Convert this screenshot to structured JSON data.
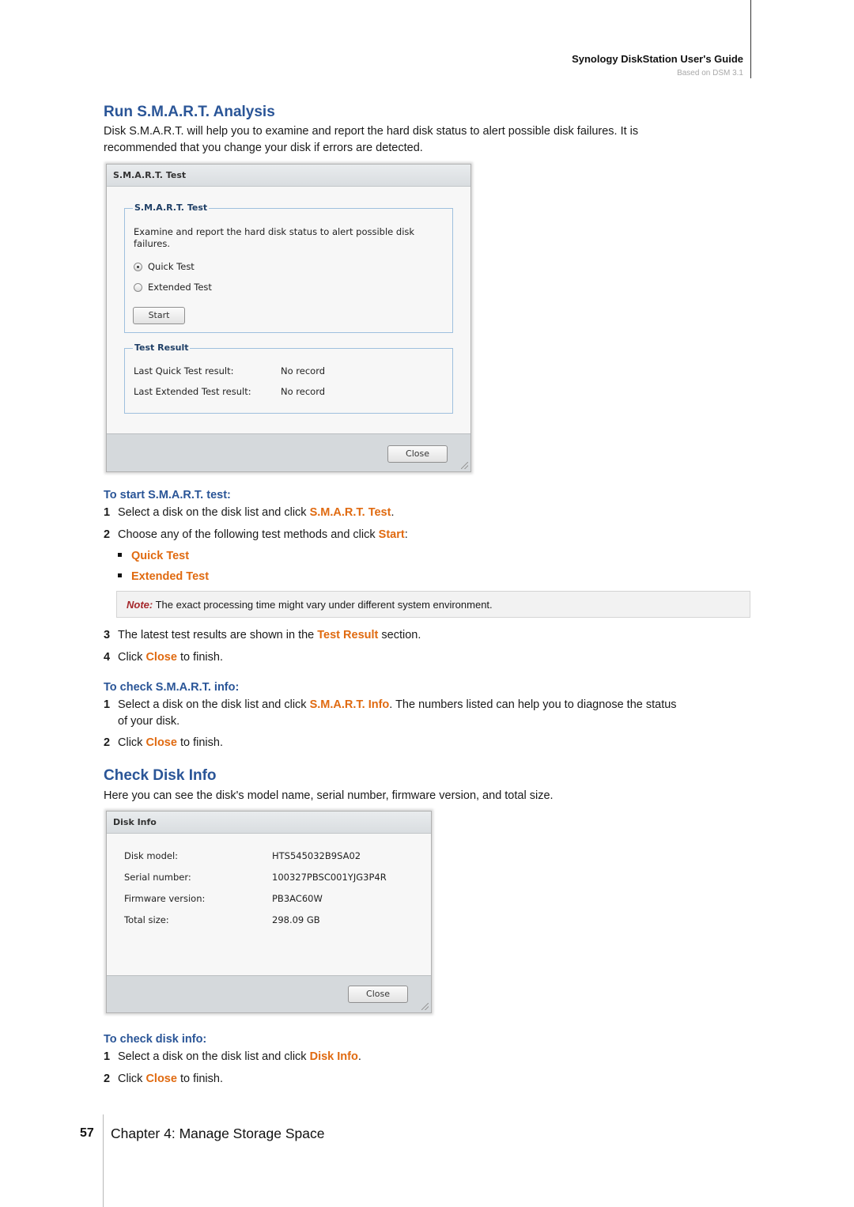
{
  "header": {
    "guide_title": "Synology DiskStation User's Guide",
    "based_on": "Based on DSM 3.1"
  },
  "smart_section": {
    "heading": "Run S.M.A.R.T. Analysis",
    "intro_line1": "Disk S.M.A.R.T. will help you to examine and report the hard disk status to alert possible disk failures. It is",
    "intro_line2": "recommended that you change your disk if errors are detected."
  },
  "smart_dialog": {
    "title": "S.M.A.R.T. Test",
    "test_group": {
      "legend": "S.M.A.R.T. Test",
      "description_line1": "Examine and report the hard disk status to alert possible disk",
      "description_line2": "failures.",
      "options": [
        {
          "label": "Quick Test",
          "selected": true
        },
        {
          "label": "Extended Test",
          "selected": false
        }
      ],
      "start_button": "Start"
    },
    "result_group": {
      "legend": "Test Result",
      "rows": [
        {
          "label": "Last Quick Test result:",
          "value": "No record"
        },
        {
          "label": "Last Extended Test result:",
          "value": "No record"
        }
      ]
    },
    "close_button": "Close"
  },
  "start_test_howto": {
    "heading": "To start S.M.A.R.T. test:",
    "steps": [
      {
        "num": "1",
        "pre": "Select a disk on the disk list and click ",
        "hl": "S.M.A.R.T. Test",
        "post": "."
      },
      {
        "num": "2",
        "pre": "Choose any of the following test methods and click ",
        "hl": "Start",
        "post": ":"
      },
      {
        "num": "3",
        "pre": "The latest test results are shown in the ",
        "hl": "Test Result",
        "post": " section."
      },
      {
        "num": "4",
        "pre": "Click ",
        "hl": "Close",
        "post": " to finish."
      }
    ],
    "bullets": [
      "Quick Test",
      "Extended Test"
    ],
    "note_label": "Note:",
    "note_text": " The exact processing time might vary under different system environment."
  },
  "check_info_howto": {
    "heading": "To check S.M.A.R.T. info:",
    "steps": [
      {
        "num": "1",
        "pre": "Select a disk on the disk list and click ",
        "hl": "S.M.A.R.T. Info",
        "post": ". The numbers listed can help you to diagnose the status",
        "cont": "of your disk."
      },
      {
        "num": "2",
        "pre": "Click ",
        "hl": "Close",
        "post": " to finish."
      }
    ]
  },
  "disk_info_section": {
    "heading": "Check Disk Info",
    "intro": "Here you can see the disk's model name, serial number, firmware version, and total size."
  },
  "disk_info_dialog": {
    "title": "Disk Info",
    "rows": [
      {
        "label": "Disk model:",
        "value": "HTS545032B9SA02"
      },
      {
        "label": "Serial number:",
        "value": "100327PBSC001YJG3P4R"
      },
      {
        "label": "Firmware version:",
        "value": "PB3AC60W"
      },
      {
        "label": "Total size:",
        "value": "298.09 GB"
      }
    ],
    "close_button": "Close"
  },
  "disk_info_howto": {
    "heading": "To check disk info:",
    "steps": [
      {
        "num": "1",
        "pre": "Select a disk on the disk list and click ",
        "hl": "Disk Info",
        "post": "."
      },
      {
        "num": "2",
        "pre": "Click ",
        "hl": "Close",
        "post": " to finish."
      }
    ]
  },
  "footer": {
    "page_number": "57",
    "chapter": "Chapter 4: Manage Storage Space"
  }
}
